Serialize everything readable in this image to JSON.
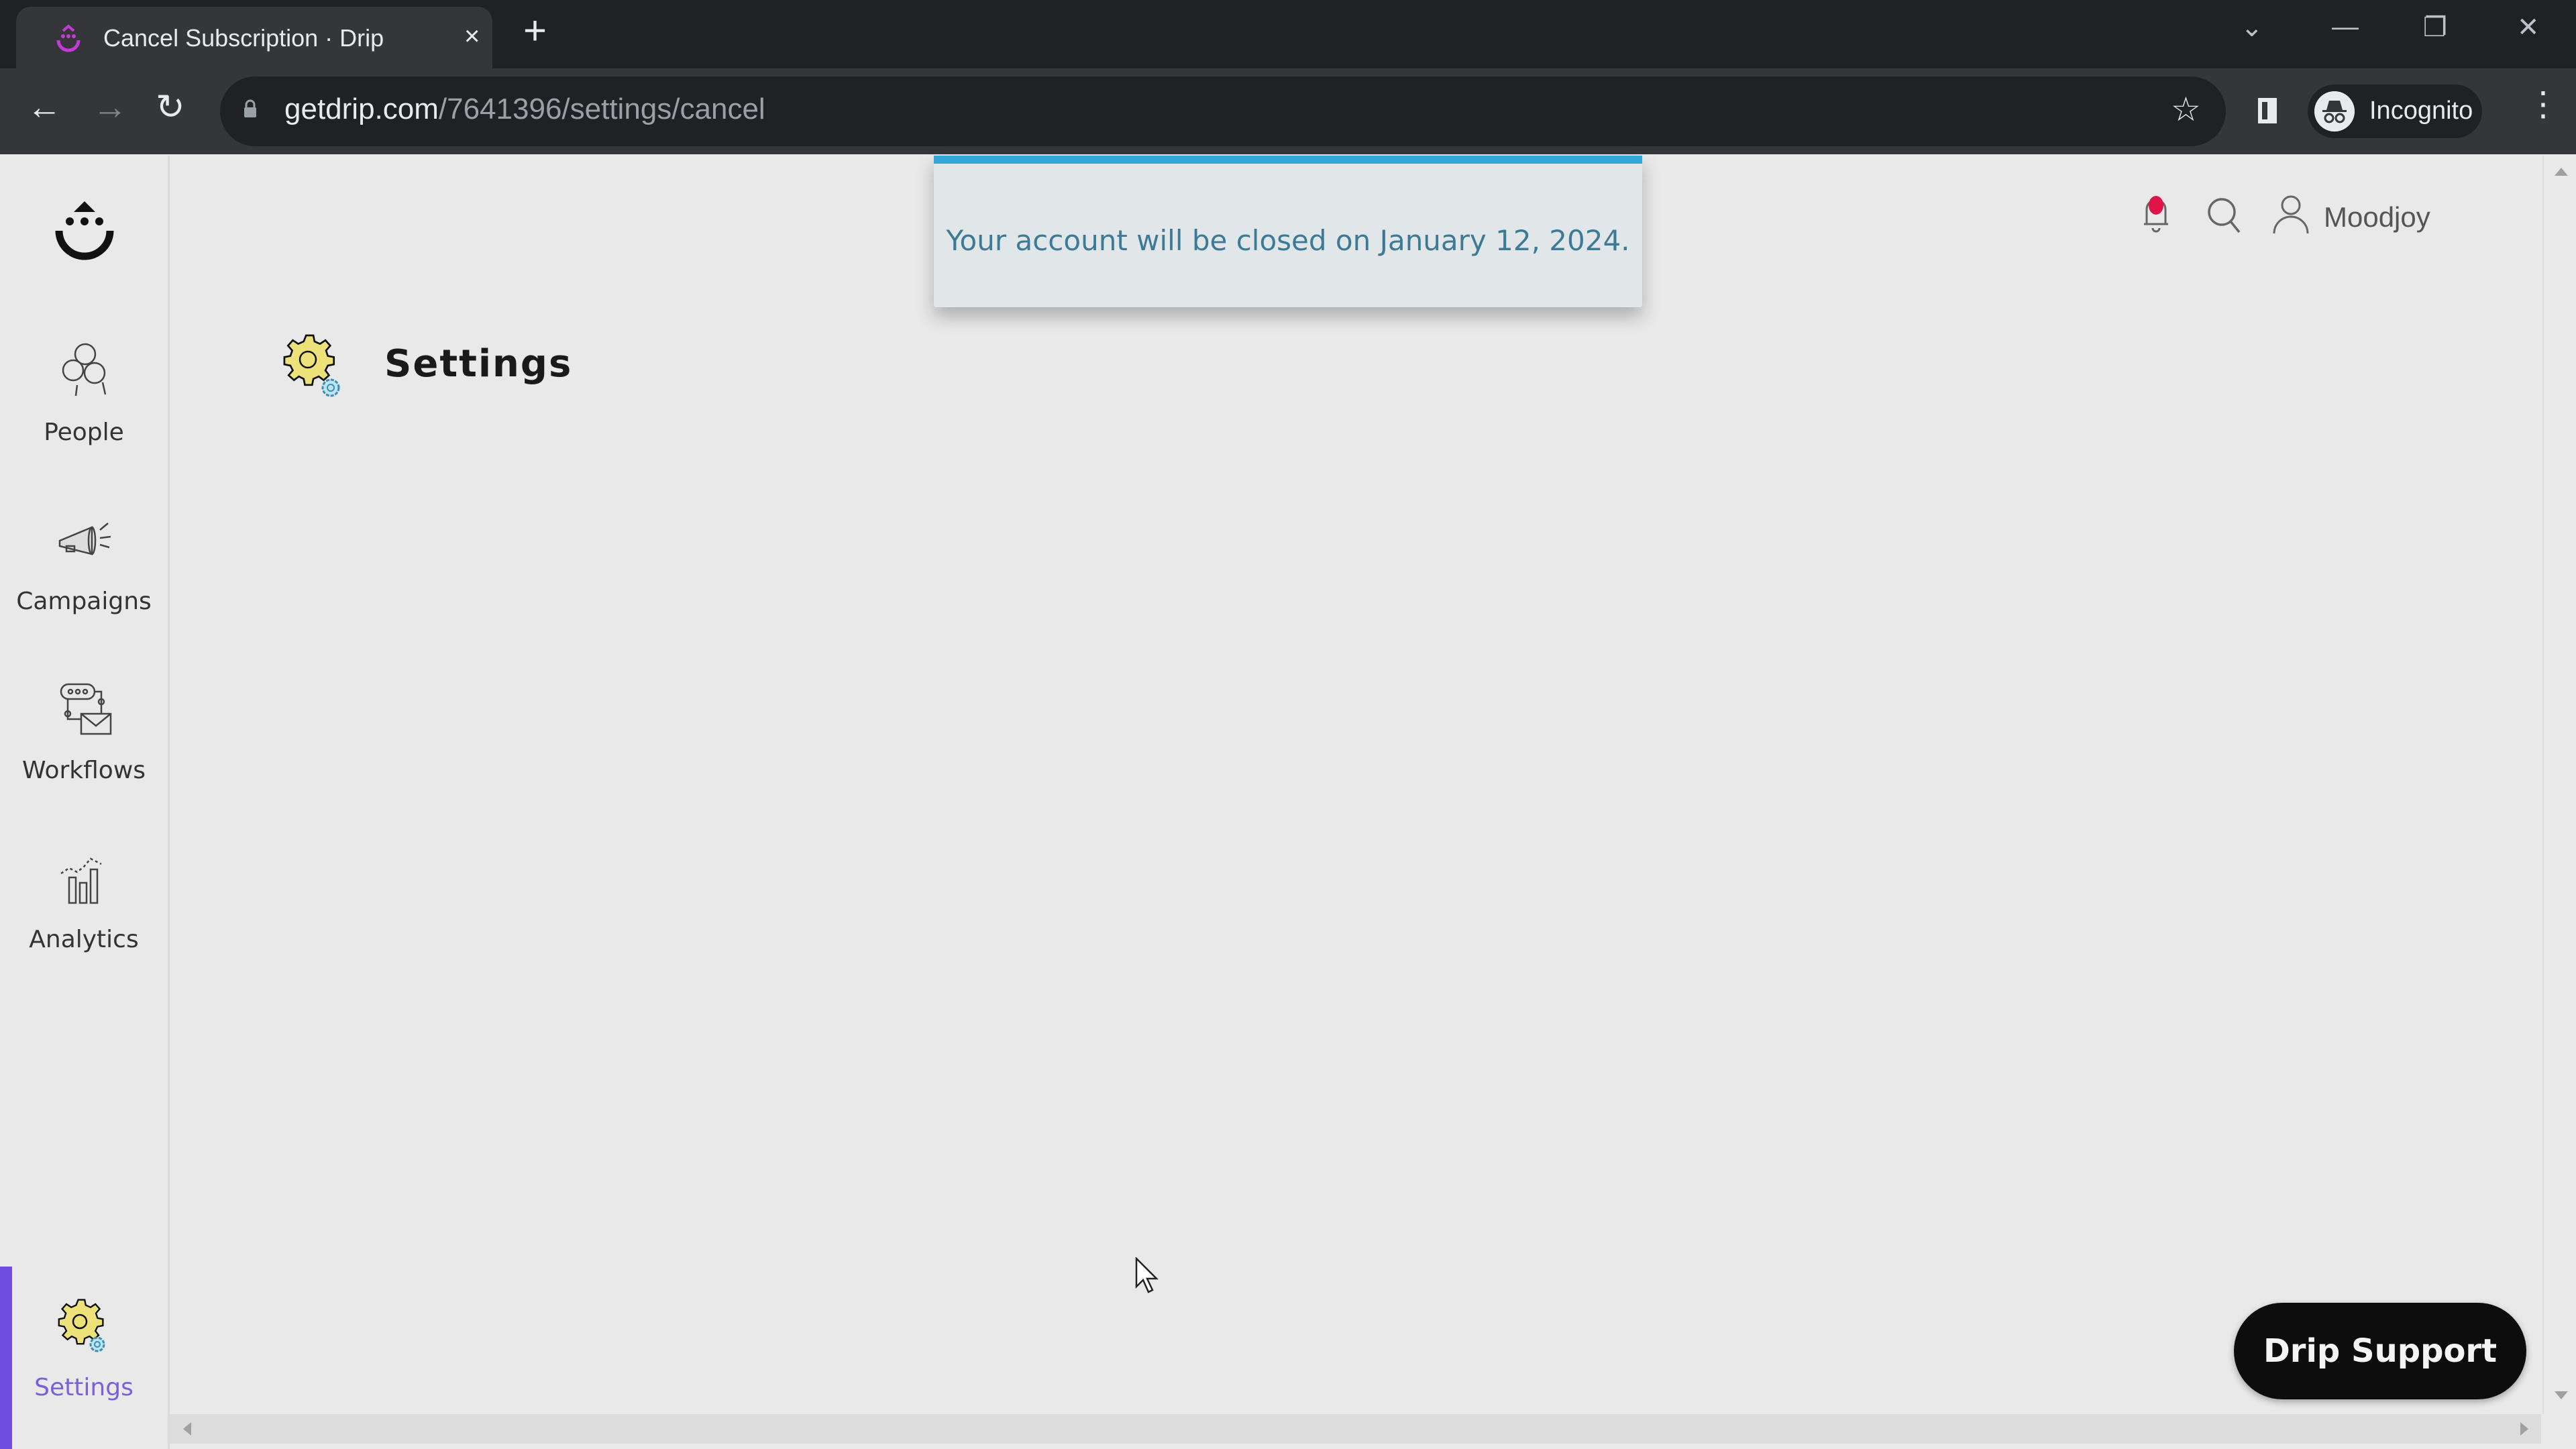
{
  "browser": {
    "tab": {
      "title": "Cancel Subscription · Drip",
      "close": "×"
    },
    "new_tab": "+",
    "window_controls": {
      "tab_search": "⌄",
      "minimize": "—",
      "restore": "❐",
      "close": "✕"
    },
    "nav": {
      "back": "←",
      "forward": "→",
      "reload": "↻"
    },
    "url": {
      "domain": "getdrip.com",
      "path": "/7641396/settings/cancel"
    },
    "bookmark_icon": "☆",
    "profile_label": "Incognito",
    "menu_icon": "⋮"
  },
  "sidebar": {
    "items": [
      {
        "label": "People",
        "icon": "people-icon"
      },
      {
        "label": "Campaigns",
        "icon": "megaphone-icon"
      },
      {
        "label": "Workflows",
        "icon": "workflow-icon"
      },
      {
        "label": "Analytics",
        "icon": "analytics-icon"
      },
      {
        "label": "Settings",
        "icon": "settings-gear-icon",
        "active": true
      }
    ]
  },
  "header": {
    "username": "Moodjoy",
    "notification_dot_color": "#e0134a"
  },
  "page": {
    "title": "Settings"
  },
  "toast": {
    "message": "Your account will be closed on January 12, 2024.",
    "accent_color": "#33a7d8"
  },
  "support_button": {
    "label": "Drip Support"
  },
  "colors": {
    "active_nav": "#6f4de0",
    "active_nav_label": "#7b61d9"
  }
}
